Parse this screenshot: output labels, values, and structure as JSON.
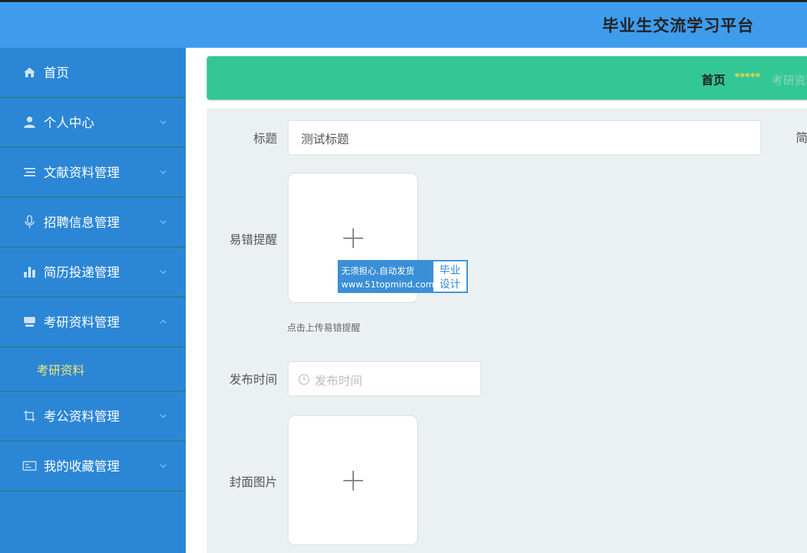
{
  "header": {
    "title": "毕业生交流学习平台"
  },
  "sidebar": {
    "items": [
      {
        "label": "首页",
        "icon": "home-icon"
      },
      {
        "label": "个人中心",
        "icon": "user-icon"
      },
      {
        "label": "文献资料管理",
        "icon": "list-icon"
      },
      {
        "label": "招聘信息管理",
        "icon": "microphone-icon"
      },
      {
        "label": "简历投递管理",
        "icon": "bar-chart-icon"
      },
      {
        "label": "考研资料管理",
        "icon": "tray-icon"
      },
      {
        "label": "考公资料管理",
        "icon": "crop-icon"
      },
      {
        "label": "我的收藏管理",
        "icon": "id-card-icon"
      }
    ],
    "submenu": {
      "label": "考研资料"
    }
  },
  "breadcrumb": {
    "home": "首页",
    "separator": "*****",
    "current": "考研资料"
  },
  "form": {
    "title_label": "标题",
    "title_value": "测试标题",
    "partial_label": "简",
    "mistake_label": "易错提醒",
    "mistake_hint": "点击上传易错提醒",
    "publish_label": "发布时间",
    "publish_placeholder": "发布时间",
    "cover_label": "封面图片"
  },
  "watermark": {
    "line1": "无须担心.自动发货",
    "line2": "www.51topmind.com",
    "right_line1": "毕业",
    "right_line2": "设计"
  },
  "colors": {
    "topbar": "#3f9ced",
    "sidebar": "#2b86d6",
    "breadcrumb": "#33c796",
    "active_submenu_text": "#f2e87a"
  }
}
